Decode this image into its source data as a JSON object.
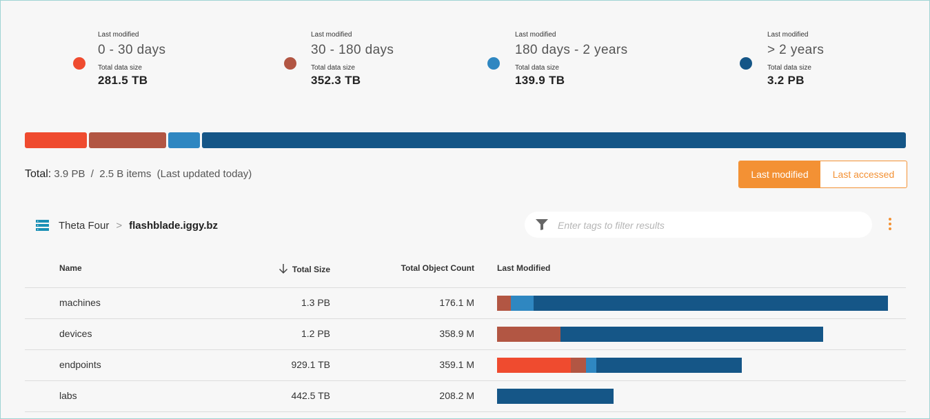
{
  "legend": [
    {
      "caption": "Last modified",
      "range": "0 - 30 days",
      "size_caption": "Total data size",
      "size": "281.5 TB",
      "color": "#ef4b2f"
    },
    {
      "caption": "Last modified",
      "range": "30 - 180 days",
      "size_caption": "Total data size",
      "size": "352.3 TB",
      "color": "#b25643"
    },
    {
      "caption": "Last modified",
      "range": "180 days - 2 years",
      "size_caption": "Total data size",
      "size": "139.9 TB",
      "color": "#2f87c1"
    },
    {
      "caption": "Last modified",
      "range": "> 2 years",
      "size_caption": "Total data size",
      "size": "3.2 PB",
      "color": "#155687"
    }
  ],
  "total_bar": [
    {
      "name": "0 - 30 days",
      "color": "#ef4b2f",
      "fraction": 0.071
    },
    {
      "name": "30 - 180 days",
      "color": "#b25643",
      "fraction": 0.088
    },
    {
      "name": "180 days - 2 years",
      "color": "#2f87c1",
      "fraction": 0.036
    },
    {
      "name": "> 2 years",
      "color": "#155687",
      "fraction": 0.805
    }
  ],
  "summary": {
    "label": "Total:",
    "text": "3.9 PB  /  2.5 B items  (Last updated today)"
  },
  "toggle": {
    "active": "Last modified",
    "inactive": "Last accessed"
  },
  "breadcrumb": {
    "parent": "Theta Four",
    "separator": ">",
    "current": "flashblade.iggy.bz"
  },
  "filter": {
    "placeholder": "Enter tags to filter results",
    "value": ""
  },
  "table": {
    "headers": {
      "name": "Name",
      "size": "Total Size",
      "count": "Total Object Count",
      "modified": "Last Modified"
    },
    "rows": [
      {
        "name": "machines",
        "size": "1.3 PB",
        "count": "176.1 M",
        "bar": [
          0,
          0.016,
          0.026,
          0.402
        ]
      },
      {
        "name": "devices",
        "size": "1.2 PB",
        "count": "358.9 M",
        "bar": [
          0,
          0.072,
          0,
          0.298
        ]
      },
      {
        "name": "endpoints",
        "size": "929.1 TB",
        "count": "359.1 M",
        "bar": [
          0.084,
          0.017,
          0.012,
          0.165
        ]
      },
      {
        "name": "labs",
        "size": "442.5 TB",
        "count": "208.2 M",
        "bar": [
          0,
          0,
          0,
          0.132
        ]
      }
    ]
  },
  "colors": {
    "accent": "#f39134",
    "range_0_30": "#ef4b2f",
    "range_30_180": "#b25643",
    "range_180_2y": "#2f87c1",
    "range_2y_plus": "#155687"
  }
}
